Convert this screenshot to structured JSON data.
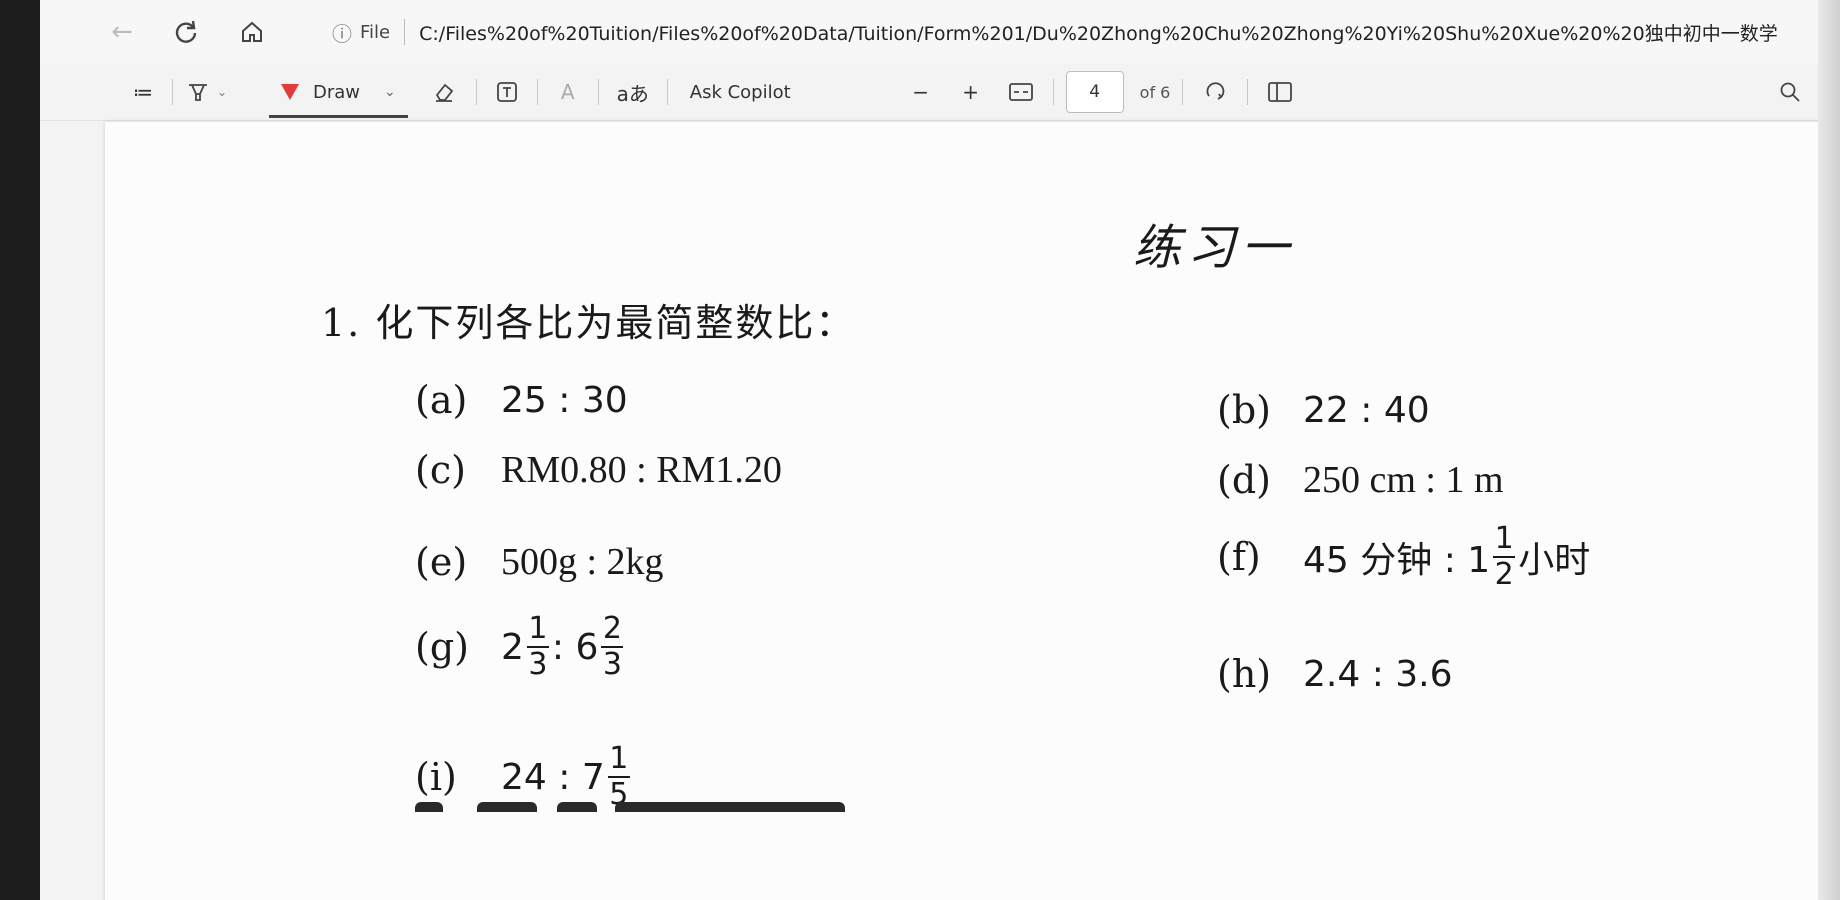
{
  "browser": {
    "file_label": "File",
    "url": "C:/Files%20of%20Tuition/Files%20of%20Data/Tuition/Form%201/Du%20Zhong%20Chu%20Zhong%20Yi%20Shu%20Xue%20%20独中初中一数学..."
  },
  "toolbar": {
    "draw_label": "Draw",
    "translate_label": "aあ",
    "copilot_label": "Ask Copilot",
    "zoom_out": "−",
    "zoom_in": "+",
    "page_current": "4",
    "page_total": "of 6",
    "text_tool": "A",
    "contents_icon": "≔"
  },
  "document": {
    "title": "练习一",
    "question": "1. 化下列各比为最简整数比：",
    "items": [
      {
        "label": "(a)",
        "expr": "25 : 30"
      },
      {
        "label": "(b)",
        "expr": "22 : 40"
      },
      {
        "label": "(c)",
        "expr": "RM0.80 : RM1.20"
      },
      {
        "label": "(d)",
        "expr": "250 cm : 1 m"
      },
      {
        "label": "(e)",
        "expr": "500g : 2kg"
      },
      {
        "label": "(f)",
        "pre": "45 分钟 : 1",
        "frac": {
          "n": "1",
          "d": "2"
        },
        "post": "小时"
      },
      {
        "label": "(g)",
        "w1": "2",
        "f1": {
          "n": "1",
          "d": "3"
        },
        "mid": " : 6",
        "f2": {
          "n": "2",
          "d": "3"
        }
      },
      {
        "label": "(h)",
        "expr": "2.4 : 3.6"
      },
      {
        "label": "(i)",
        "pre": "24 : 7",
        "frac": {
          "n": "1",
          "d": "5"
        }
      }
    ]
  }
}
